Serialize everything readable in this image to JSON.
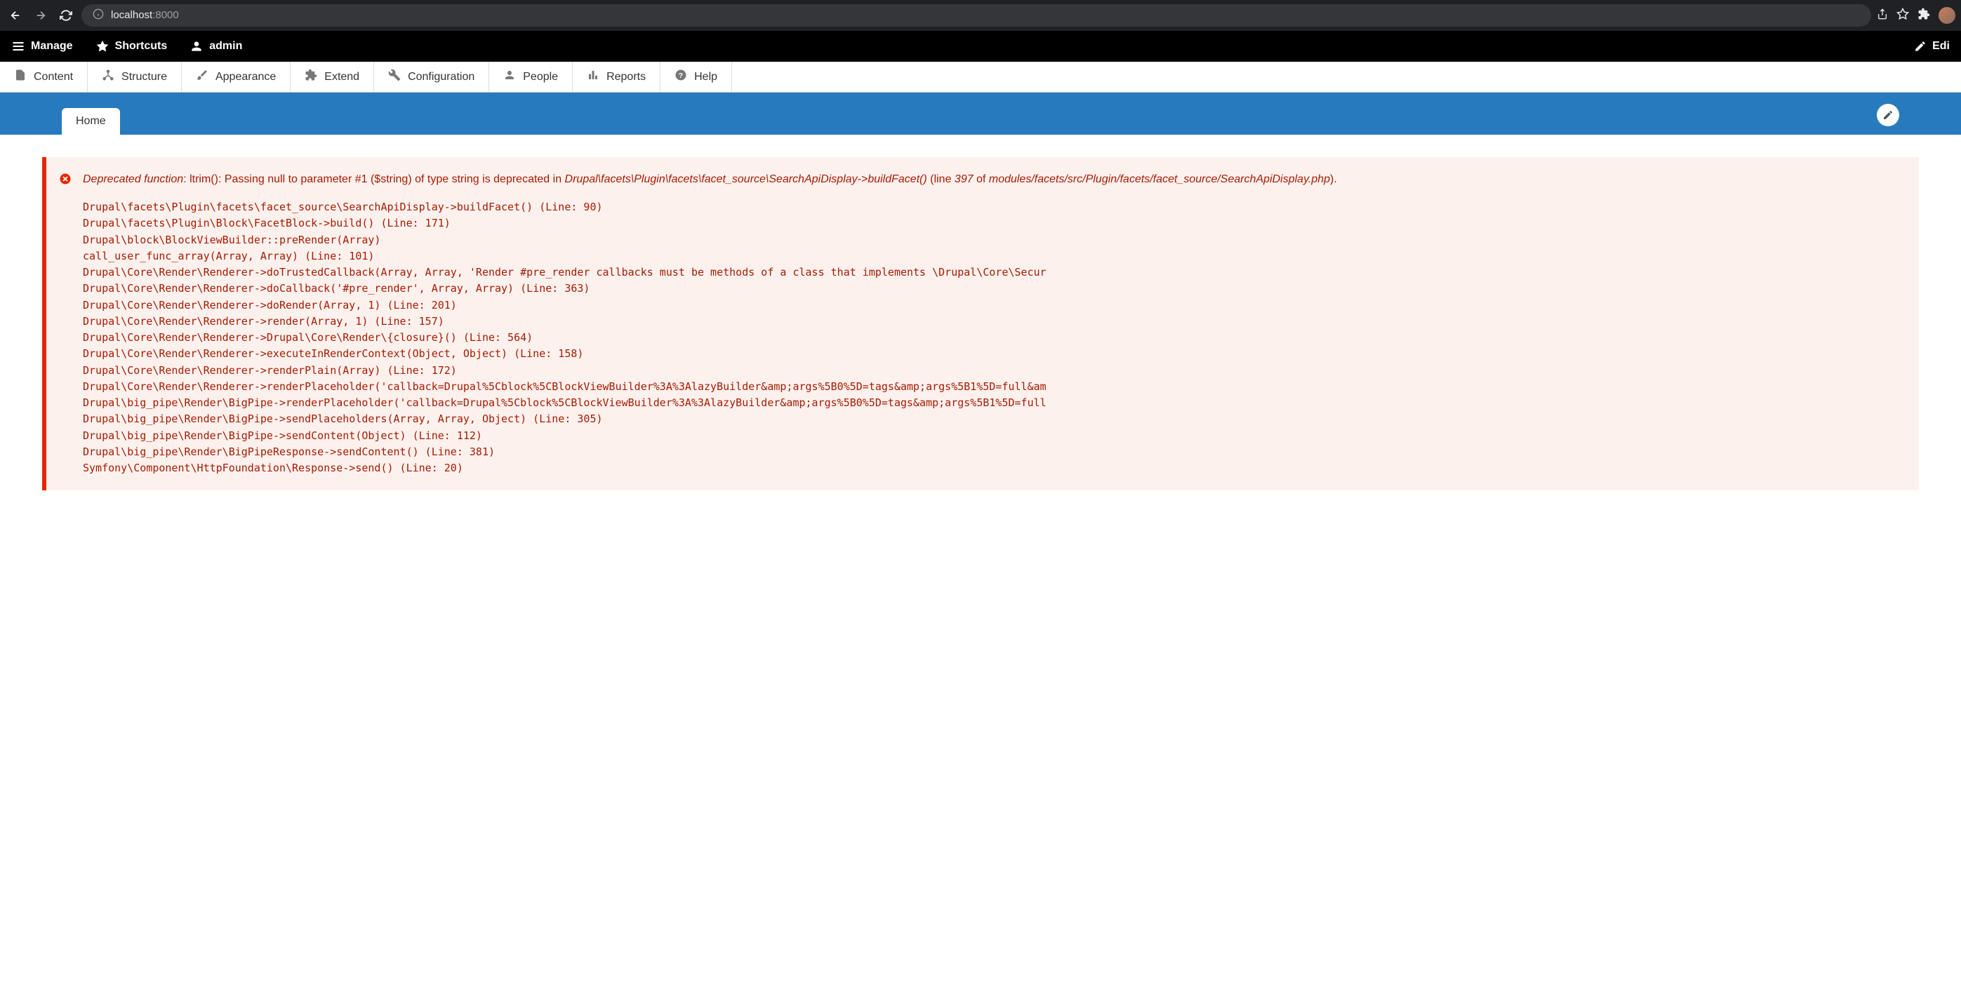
{
  "browser": {
    "url_host": "localhost",
    "url_port": ":8000"
  },
  "toolbar": {
    "manage": "Manage",
    "shortcuts": "Shortcuts",
    "admin": "admin",
    "edit": "Edi"
  },
  "admin_menu": {
    "content": "Content",
    "structure": "Structure",
    "appearance": "Appearance",
    "extend": "Extend",
    "configuration": "Configuration",
    "people": "People",
    "reports": "Reports",
    "help": "Help"
  },
  "tabs": {
    "home": "Home"
  },
  "error": {
    "label": "Deprecated function",
    "msg1": ": ltrim(): Passing null to parameter #1 ($string) of type string is deprecated in ",
    "class": "Drupal\\facets\\Plugin\\facets\\facet_source\\SearchApiDisplay->buildFacet()",
    "msg2": " (line ",
    "line": "397",
    "msg3": " of ",
    "file": "modules/facets/src/Plugin/facets/facet_source/SearchApiDisplay.php",
    "msg4": ").",
    "stack": "Drupal\\facets\\Plugin\\facets\\facet_source\\SearchApiDisplay->buildFacet() (Line: 90)\nDrupal\\facets\\Plugin\\Block\\FacetBlock->build() (Line: 171)\nDrupal\\block\\BlockViewBuilder::preRender(Array)\ncall_user_func_array(Array, Array) (Line: 101)\nDrupal\\Core\\Render\\Renderer->doTrustedCallback(Array, Array, 'Render #pre_render callbacks must be methods of a class that implements \\Drupal\\Core\\Secur\nDrupal\\Core\\Render\\Renderer->doCallback('#pre_render', Array, Array) (Line: 363)\nDrupal\\Core\\Render\\Renderer->doRender(Array, 1) (Line: 201)\nDrupal\\Core\\Render\\Renderer->render(Array, 1) (Line: 157)\nDrupal\\Core\\Render\\Renderer->Drupal\\Core\\Render\\{closure}() (Line: 564)\nDrupal\\Core\\Render\\Renderer->executeInRenderContext(Object, Object) (Line: 158)\nDrupal\\Core\\Render\\Renderer->renderPlain(Array) (Line: 172)\nDrupal\\Core\\Render\\Renderer->renderPlaceholder('callback=Drupal%5Cblock%5CBlockViewBuilder%3A%3AlazyBuilder&amp;args%5B0%5D=tags&amp;args%5B1%5D=full&am\nDrupal\\big_pipe\\Render\\BigPipe->renderPlaceholder('callback=Drupal%5Cblock%5CBlockViewBuilder%3A%3AlazyBuilder&amp;args%5B0%5D=tags&amp;args%5B1%5D=full\nDrupal\\big_pipe\\Render\\BigPipe->sendPlaceholders(Array, Array, Object) (Line: 305)\nDrupal\\big_pipe\\Render\\BigPipe->sendContent(Object) (Line: 112)\nDrupal\\big_pipe\\Render\\BigPipeResponse->sendContent() (Line: 381)\nSymfony\\Component\\HttpFoundation\\Response->send() (Line: 20)"
  }
}
